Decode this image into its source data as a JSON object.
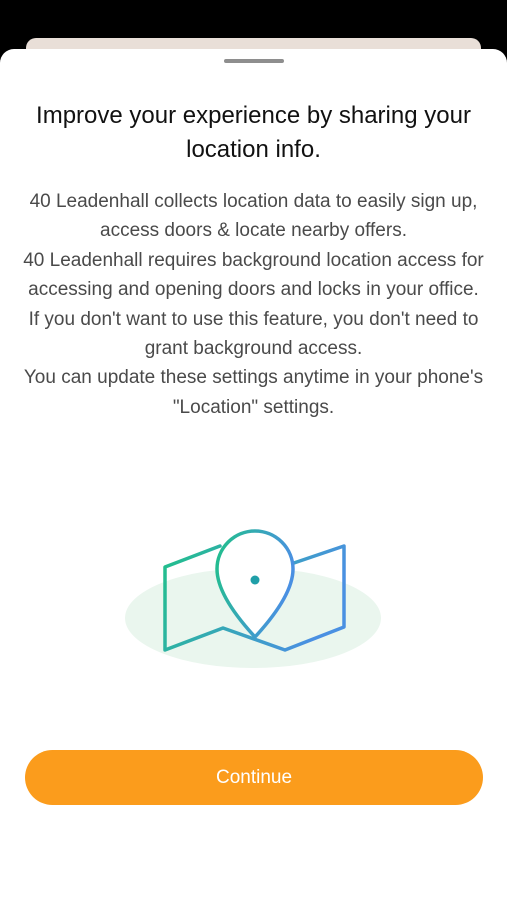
{
  "dialog": {
    "title": "Improve your experience by sharing your location info.",
    "paragraphs": [
      "40 Leadenhall collects location data to easily sign up, access doors & locate nearby offers.",
      "40 Leadenhall requires background location access for accessing and opening doors and locks in your office. If you don't want to use this feature, you don't need to grant background access.",
      "You can update these settings anytime in your phone's \"Location\" settings."
    ],
    "continue_label": "Continue",
    "illustration_icon": "map-with-location-pin-icon"
  },
  "colors": {
    "accent_button": "#fb9c1c",
    "illustration_gradient_start": "#21c08a",
    "illustration_gradient_end": "#4a90e2",
    "title_text": "#111111",
    "body_text": "#4a4a4a"
  }
}
